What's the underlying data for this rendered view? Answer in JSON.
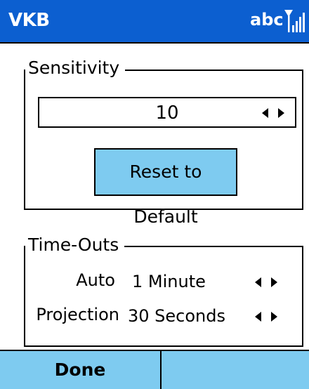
{
  "window": {
    "title": "VKB",
    "input_mode": "abc",
    "signal_icon": "signal-strength-icon"
  },
  "colors": {
    "titlebar": "#0c5fd0",
    "accent": "#7ecbf0",
    "border": "#000000",
    "background": "#ffffff"
  },
  "sensitivity": {
    "legend": "Sensitivity",
    "value": "10",
    "reset_label": "Reset to Default"
  },
  "timeouts": {
    "legend": "Time-Outs",
    "rows": [
      {
        "label": "Auto",
        "value": "1 Minute"
      },
      {
        "label": "Projection",
        "value": "30 Seconds"
      }
    ]
  },
  "softkeys": {
    "left": "Done",
    "right": ""
  }
}
